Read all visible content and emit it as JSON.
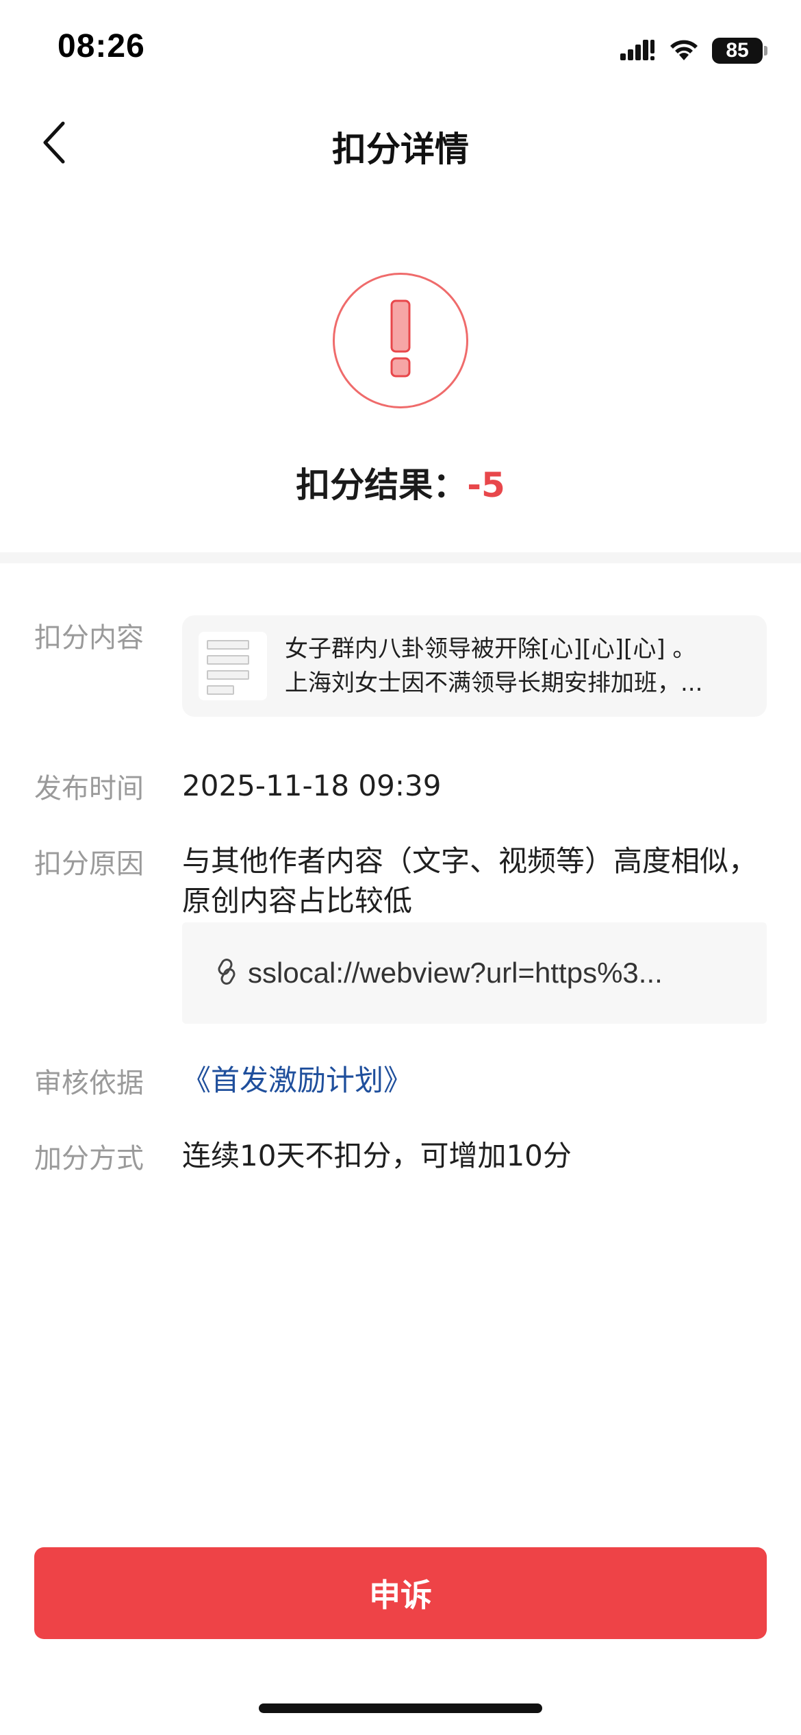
{
  "status_bar": {
    "time": "08:26",
    "battery_level": "85",
    "icons": [
      "cellular-signal-icon",
      "wifi-icon",
      "battery-icon"
    ]
  },
  "nav": {
    "title": "扣分详情",
    "back_icon": "chevron-left-icon"
  },
  "result": {
    "label": "扣分结果：",
    "value": "-5",
    "icon": "exclamation-icon"
  },
  "details": {
    "content": {
      "label": "扣分内容",
      "line1": "女子群内八卦领导被开除[心][心][心] 。",
      "line2": "上海刘女士因不满领导长期安排加班，..."
    },
    "publish_time": {
      "label": "发布时间",
      "value": "2025-11-18 09:39"
    },
    "reason": {
      "label": "扣分原因",
      "line1": "与其他作者内容（文字、视频等）高度相似，",
      "line2": "原创内容占比较低",
      "link": "sslocal://webview?url=https%3..."
    },
    "basis": {
      "label": "审核依据",
      "value": "《首发激励计划》"
    },
    "bonus": {
      "label": "加分方式",
      "value": "连续10天不扣分，可增加10分"
    }
  },
  "actions": {
    "appeal_label": "申诉"
  },
  "colors": {
    "accent_red": "#ee4347",
    "result_red": "#e8474b",
    "link_blue": "#1f4f9c",
    "label_gray": "#9a9a9a"
  }
}
